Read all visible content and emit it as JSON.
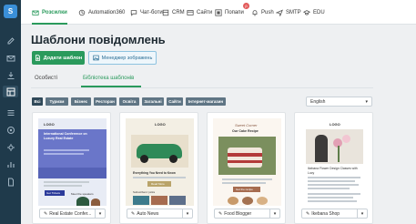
{
  "nav": {
    "items": [
      {
        "label": "Розсилки",
        "icon": "mail-icon"
      },
      {
        "label": "Automation360",
        "icon": "automation-icon"
      },
      {
        "label": "Чат-боти",
        "icon": "chat-icon"
      },
      {
        "label": "CRM",
        "icon": "crm-icon"
      },
      {
        "label": "Сайти",
        "icon": "sites-icon"
      },
      {
        "label": "Попапи",
        "icon": "popup-icon",
        "badge": "β"
      },
      {
        "label": "Push",
        "icon": "bell-icon"
      },
      {
        "label": "SMTP",
        "icon": "smtp-icon"
      },
      {
        "label": "EDU",
        "icon": "graduation-icon"
      }
    ]
  },
  "page": {
    "title": "Шаблони повідомлень",
    "add_button": "Додати шаблон",
    "image_manager_button": "Менеджер зображень"
  },
  "tabs": [
    {
      "label": "Особисті"
    },
    {
      "label": "Бібліотека шаблонів",
      "active": true
    }
  ],
  "chips": [
    "Всі",
    "Туризм",
    "Бізнес",
    "Ресторан",
    "Освіта",
    "Загальні",
    "Сайти",
    "Інтернет-магазин"
  ],
  "language": {
    "selected": "English"
  },
  "templates": [
    {
      "name": "Real Estate Confer...",
      "preview": {
        "brand": "LOGO",
        "headline": "International Conference on Luxury Real Estate",
        "button": "Get Tickets",
        "caption": "Meet the speakers"
      }
    },
    {
      "name": "Auto News",
      "preview": {
        "brand": "LOGO",
        "headline": "Everything You Need to Know",
        "button": "Read More",
        "caption": "Subscribers' picks"
      }
    },
    {
      "name": "Food Blogger",
      "preview": {
        "brand": "Sweet Corner",
        "headline": "Our Cake Recipe",
        "button": "Get the recipe"
      }
    },
    {
      "name": "Ikebana Shop",
      "preview": {
        "brand": "LOGO",
        "headline": "Ikebana Flower Design Classes with Lucy"
      }
    }
  ],
  "colors": {
    "accent": "#2a9a5c",
    "sidebar": "#1f3a4b",
    "chip": "#5f7584"
  }
}
